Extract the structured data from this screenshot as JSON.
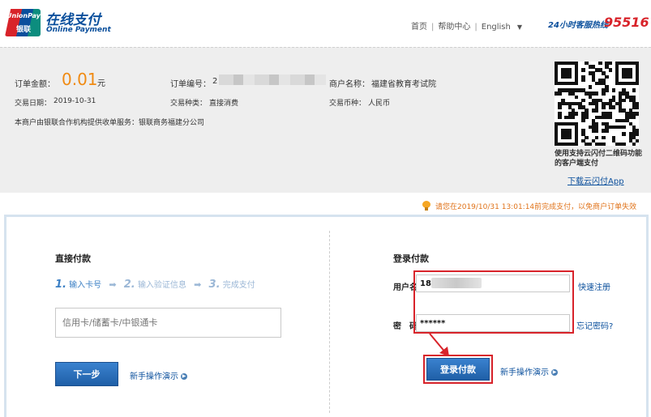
{
  "header": {
    "logo_text_en": "UnionPay",
    "logo_text_cn": "银联",
    "brand_cn": "在线支付",
    "brand_en": "Online Payment",
    "nav": {
      "home": "首页",
      "help": "帮助中心",
      "language": "English"
    },
    "hotline_label": "24小时客服热线",
    "hotline_number": "95516"
  },
  "order": {
    "amount_label": "订单金额：",
    "amount_value": "0.01",
    "amount_unit": "元",
    "order_no_label": "订单编号：",
    "order_no_value": "2",
    "merchant_label": "商户名称：",
    "merchant_value": "福建省教育考试院",
    "date_label": "交易日期：",
    "date_value": "2019-10-31",
    "type_label": "交易种类：",
    "type_value": "直接消费",
    "currency_label": "交易币种：",
    "currency_value": "人民币",
    "provider_note": "本商户由银联合作机构提供收单服务：银联商务福建分公司",
    "qr_note": "使用支持云闪付二维码功能的客户端支付",
    "qr_link": "下载云闪付App"
  },
  "notice": {
    "text": "请您在2019/10/31 13:01:14前完成支付，以免商户订单失效"
  },
  "direct_pay": {
    "title": "直接付款",
    "steps": [
      {
        "num": "1.",
        "label": "输入卡号"
      },
      {
        "num": "2.",
        "label": "输入验证信息"
      },
      {
        "num": "3.",
        "label": "完成支付"
      }
    ],
    "card_placeholder": "信用卡/储蓄卡/中银通卡",
    "next_button": "下一步",
    "demo_link": "新手操作演示"
  },
  "login_pay": {
    "title": "登录付款",
    "username_label": "用户名：",
    "username_value": "18",
    "register_link": "快速注册",
    "password_label": "密　码：",
    "password_value": "******",
    "forgot_link": "忘记密码?",
    "login_button": "登录付款",
    "demo_link": "新手操作演示"
  }
}
